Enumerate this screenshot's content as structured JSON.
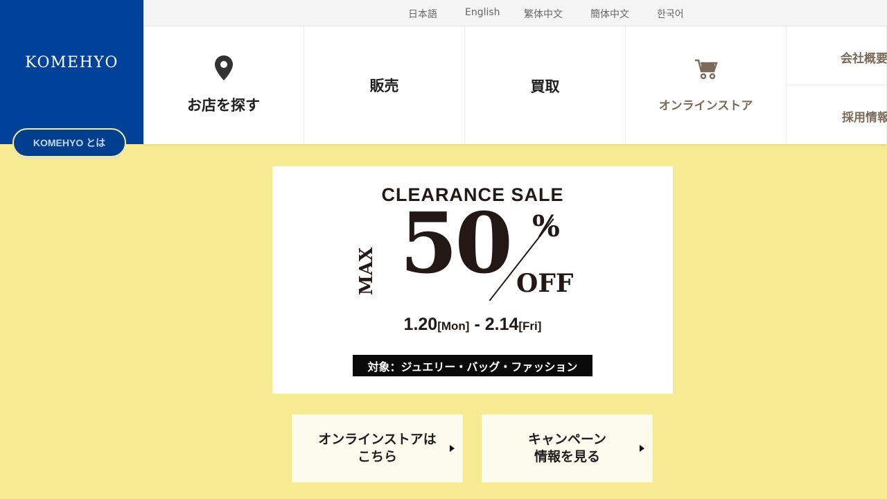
{
  "brand": {
    "logo": "KOMEHYO",
    "about_button": "KOMEHYO とは"
  },
  "languages": [
    "日本語",
    "English",
    "繁体中文",
    "簡体中文",
    "한국어"
  ],
  "nav": {
    "find_store": "お店を探す",
    "sell": "販売",
    "buy": "買取",
    "online_store": "オンラインストア",
    "company": "会社概要",
    "recruit": "採用情報"
  },
  "banner": {
    "title": "CLEARANCE SALE",
    "max": "MAX",
    "percent_value": "50",
    "percent_sign": "%",
    "off": "OFF",
    "date_start": "1.20",
    "date_start_day": "[Mon]",
    "date_sep": "-",
    "date_end": "2.14",
    "date_end_day": "[Fri]",
    "target": "対象：ジュエリー・バッグ・ファッション"
  },
  "cta": {
    "online": "オンラインストアは\nこちら",
    "campaign": "キャンペーン\n情報を見る"
  },
  "colors": {
    "brand_blue": "#004299",
    "background_yellow": "#f6eb92",
    "online_brown": "#7b6a5a"
  }
}
